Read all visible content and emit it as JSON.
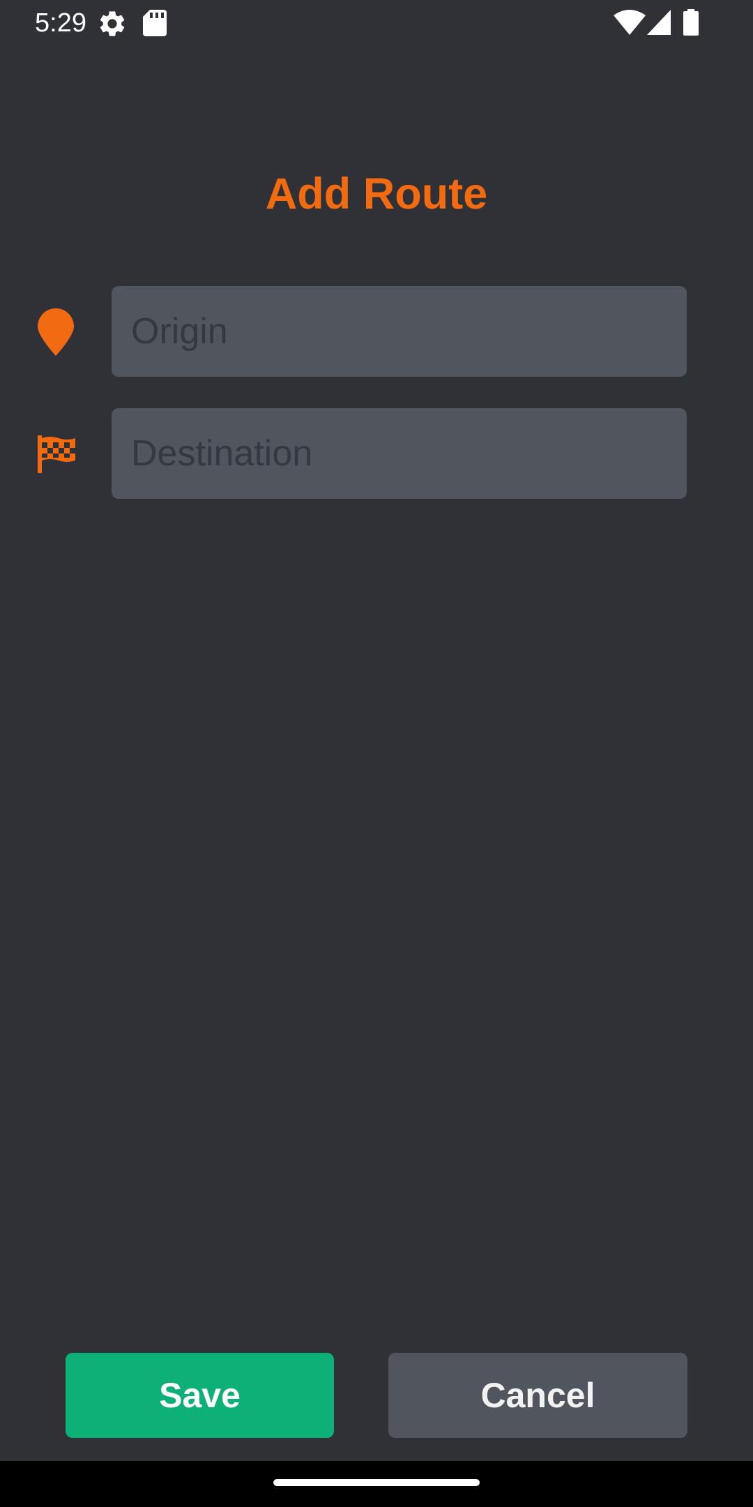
{
  "status_bar": {
    "time": "5:29",
    "icons": [
      "settings-gear-icon",
      "sd-card-icon",
      "wifi-icon",
      "cell-signal-icon",
      "battery-icon"
    ]
  },
  "page": {
    "title": "Add Route"
  },
  "form": {
    "origin": {
      "icon": "map-pin-icon",
      "value": "",
      "placeholder": "Origin"
    },
    "destination": {
      "icon": "checkered-flag-icon",
      "value": "",
      "placeholder": "Destination"
    }
  },
  "actions": {
    "save_label": "Save",
    "cancel_label": "Cancel"
  },
  "colors": {
    "background": "#303136",
    "accent": "#f26b10",
    "field_background": "#51555e",
    "save_button": "#0db076",
    "cancel_button": "#51555e"
  }
}
